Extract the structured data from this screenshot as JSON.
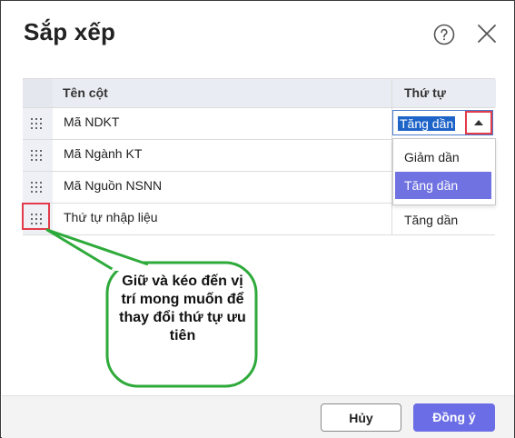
{
  "dialog": {
    "title": "Sắp xếp",
    "help_icon": "question-circle-icon",
    "close_icon": "close-x-icon"
  },
  "table": {
    "headers": {
      "name": "Tên cột",
      "order": "Thứ tự"
    },
    "rows": [
      {
        "name": "Mã NDKT",
        "order": "Tăng dần"
      },
      {
        "name": "Mã Ngành KT",
        "order": ""
      },
      {
        "name": "Mã Nguồn NSNN",
        "order": ""
      },
      {
        "name": "Thứ tự nhập liệu",
        "order": "Tăng dần"
      }
    ]
  },
  "dropdown": {
    "current": "Tăng dần",
    "options": [
      "Giảm dần",
      "Tăng dần"
    ],
    "selected_index": 1
  },
  "annotation": {
    "callout_text": "Giữ và kéo đến vị trí mong muốn để thay đổi thứ tự ưu tiên",
    "highlight_color": "#e23b4a",
    "callout_color": "#2eaa3a"
  },
  "footer": {
    "cancel_label": "Hủy",
    "ok_label": "Đồng ý"
  },
  "colors": {
    "accent": "#6a6de5",
    "selection": "#1e64c8"
  }
}
